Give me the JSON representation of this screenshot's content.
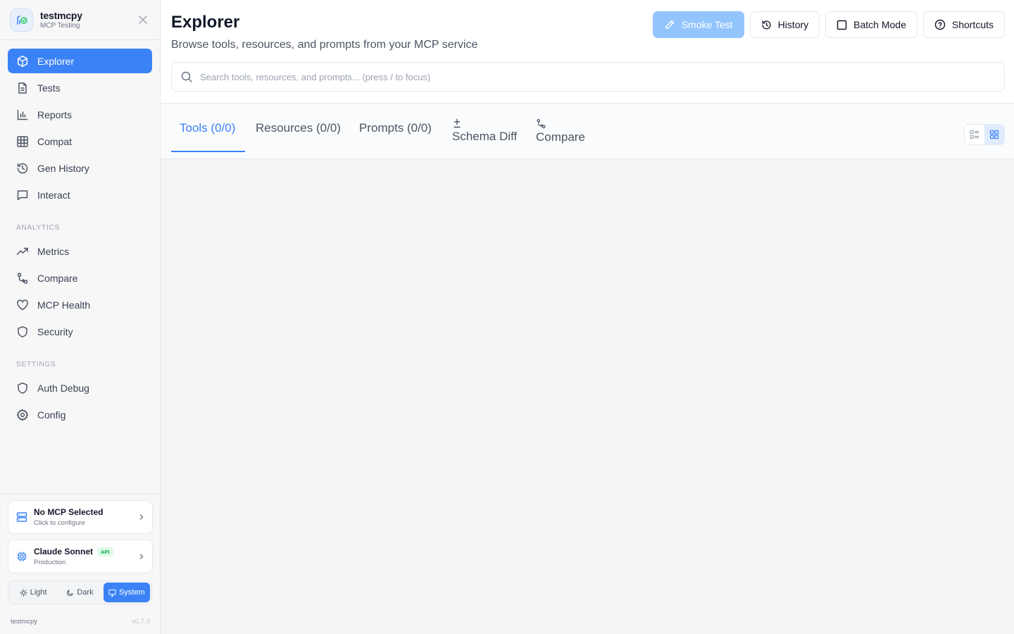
{
  "brand": {
    "title": "testmcpy",
    "subtitle": "MCP Testing",
    "logo_icon": "mcp-logo-icon"
  },
  "nav": {
    "main": [
      {
        "label": "Explorer",
        "icon": "cube-icon",
        "active": true
      },
      {
        "label": "Tests",
        "icon": "document-icon"
      },
      {
        "label": "Reports",
        "icon": "bar-chart-icon"
      },
      {
        "label": "Compat",
        "icon": "grid-icon"
      },
      {
        "label": "Gen History",
        "icon": "history-icon"
      },
      {
        "label": "Interact",
        "icon": "chat-icon"
      }
    ],
    "analytics_label": "ANALYTICS",
    "analytics": [
      {
        "label": "Metrics",
        "icon": "trending-up-icon"
      },
      {
        "label": "Compare",
        "icon": "compare-icon"
      },
      {
        "label": "MCP Health",
        "icon": "heart-icon"
      },
      {
        "label": "Security",
        "icon": "shield-icon"
      }
    ],
    "settings_label": "SETTINGS",
    "settings": [
      {
        "label": "Auth Debug",
        "icon": "shield-icon"
      },
      {
        "label": "Config",
        "icon": "gear-icon"
      }
    ]
  },
  "mcp_card": {
    "title": "No MCP Selected",
    "subtitle": "Click to configure"
  },
  "model_card": {
    "title": "Claude Sonnet",
    "badge": "API",
    "subtitle": "Production"
  },
  "theme": {
    "light": "Light",
    "dark": "Dark",
    "system": "System",
    "selected": "System"
  },
  "footer": {
    "name": "testmcpy",
    "version": "v0.7.3"
  },
  "page": {
    "title": "Explorer",
    "subtitle": "Browse tools, resources, and prompts from your MCP service"
  },
  "actions": {
    "smoke_test": "Smoke Test",
    "history": "History",
    "batch_mode": "Batch Mode",
    "shortcuts": "Shortcuts"
  },
  "search": {
    "placeholder": "Search tools, resources, and prompts... (press / to focus)",
    "value": ""
  },
  "tabs": [
    {
      "label": "Tools (0/0)",
      "active": true
    },
    {
      "label": "Resources (0/0)"
    },
    {
      "label": "Prompts (0/0)"
    },
    {
      "label": "Schema Diff",
      "icon": "plus-minus-icon"
    },
    {
      "label": "Compare",
      "icon": "compare-icon"
    }
  ],
  "view_toggle": {
    "options": [
      "list-view-icon",
      "grid-view-icon"
    ],
    "selected": "grid-view-icon"
  },
  "colors": {
    "accent": "#3b82f6",
    "accent_light": "#93c5fd",
    "success": "#16a34a"
  }
}
